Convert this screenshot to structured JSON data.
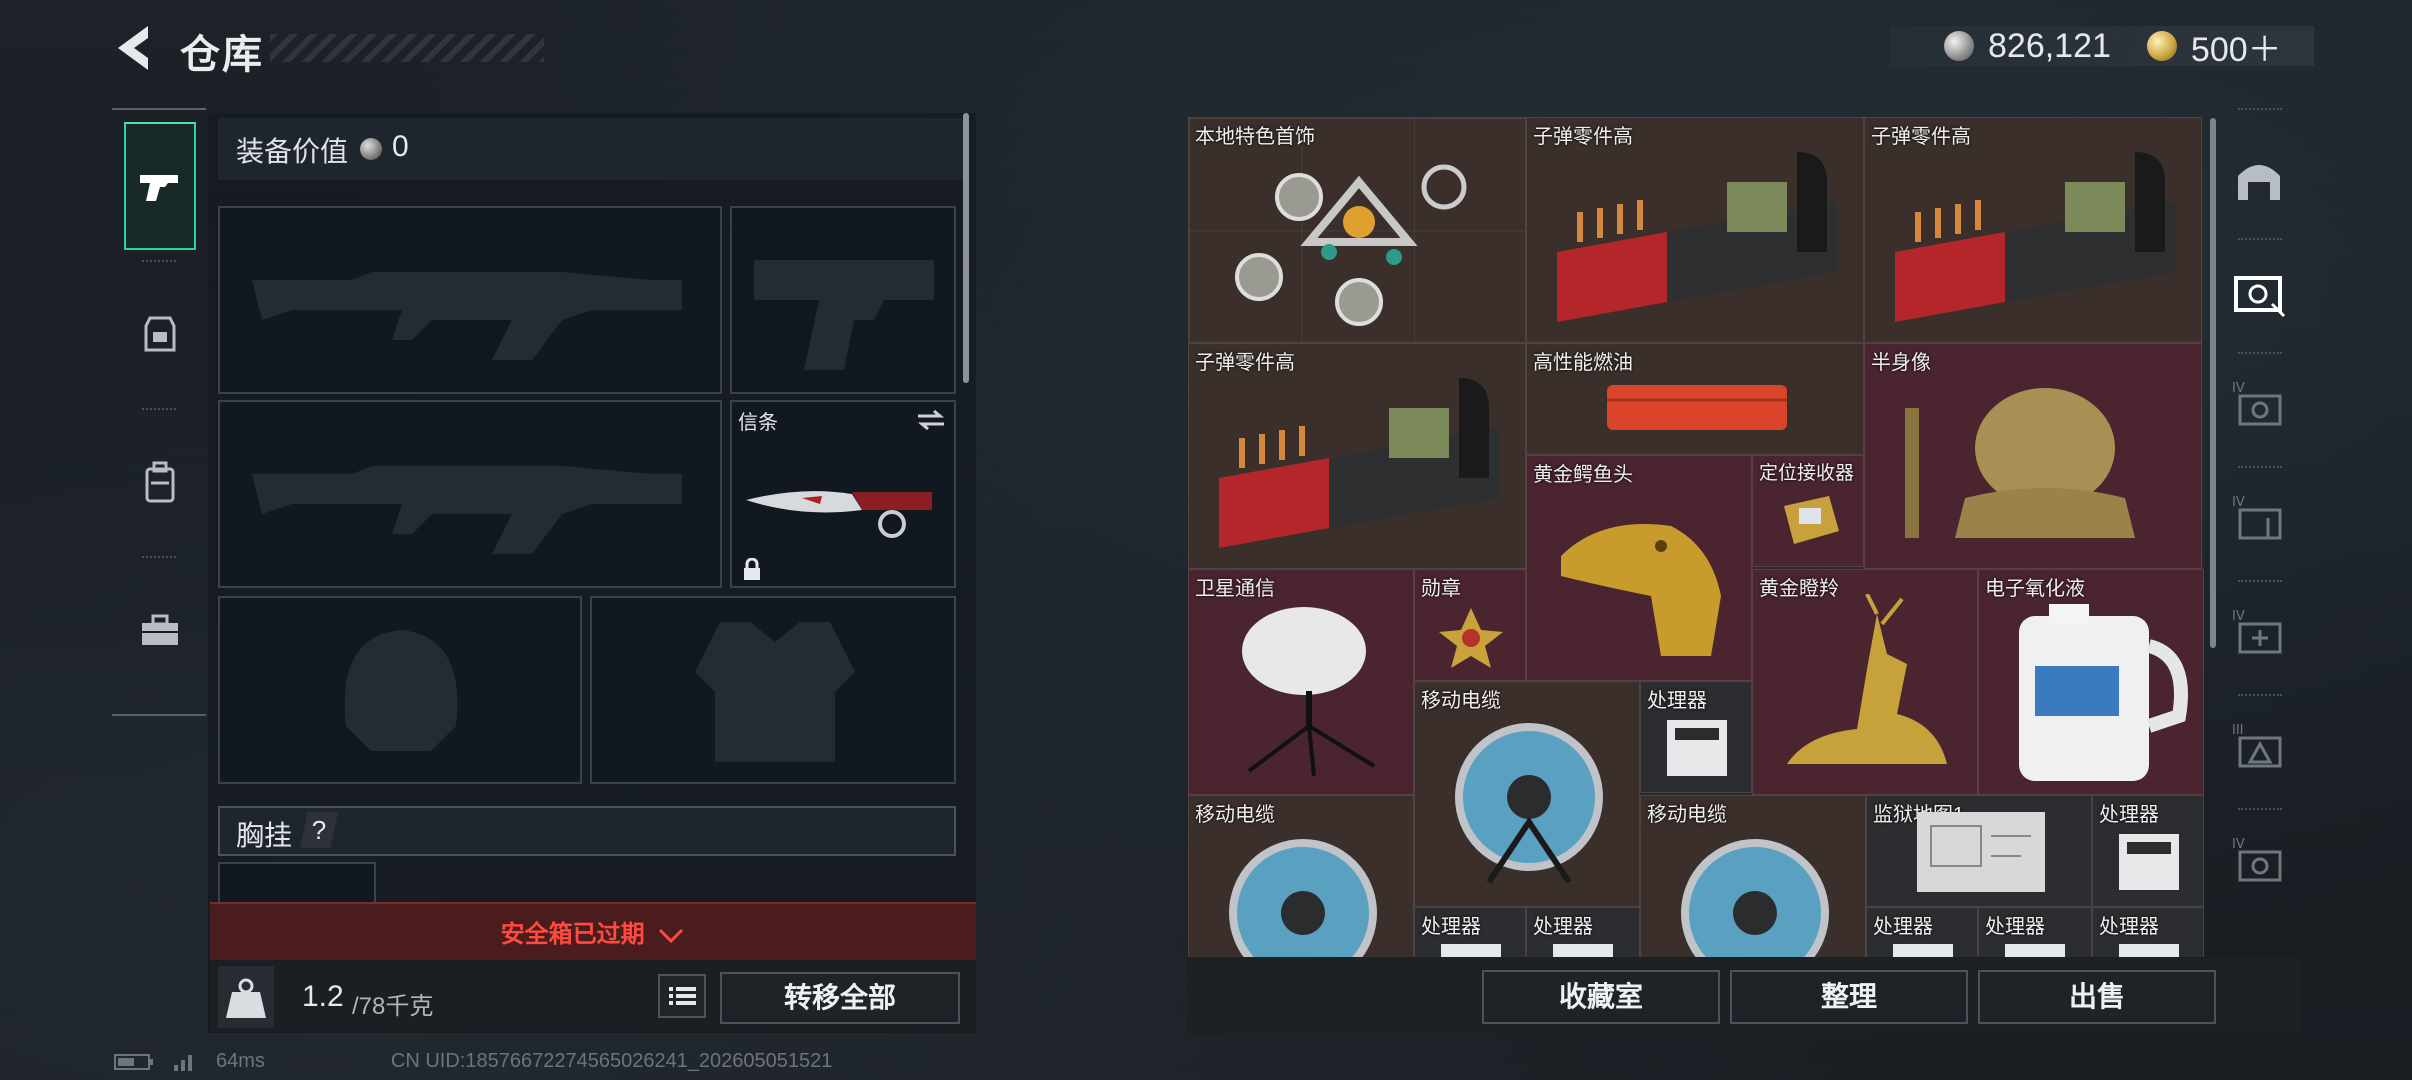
{
  "header": {
    "title": "仓库",
    "currency": [
      {
        "icon": "silver-coin-icon",
        "value": "826,121"
      },
      {
        "icon": "gold-coin-icon",
        "value": "500＋"
      }
    ]
  },
  "left_tabs": [
    {
      "icon": "pistol-icon",
      "active": true
    },
    {
      "icon": "backpack-armor-icon",
      "active": false
    },
    {
      "icon": "backpack-icon",
      "active": false
    },
    {
      "icon": "toolbox-icon",
      "active": false
    }
  ],
  "equipment": {
    "value_label": "装备价值",
    "value": "0",
    "melee_label": "信条",
    "chest_label": "胸挂",
    "chest_help": "?",
    "safebox_text": "安全箱已过期",
    "weight_current": "1.2",
    "weight_max": "/78千克",
    "transfer_all": "转移全部"
  },
  "storage": {
    "items": [
      {
        "name": "本地特色首饰"
      },
      {
        "name": "子弹零件高"
      },
      {
        "name": "子弹零件高"
      },
      {
        "name": "子弹零件高"
      },
      {
        "name": "高性能燃油"
      },
      {
        "name": "半身像"
      },
      {
        "name": "黄金鳄鱼头"
      },
      {
        "name": "定位接收器"
      },
      {
        "name": "卫星通信"
      },
      {
        "name": "勋章"
      },
      {
        "name": "黄金瞪羚"
      },
      {
        "name": "电子氧化液"
      },
      {
        "name": "移动电缆"
      },
      {
        "name": "处理器"
      },
      {
        "name": "移动电缆"
      },
      {
        "name": "移动电缆"
      },
      {
        "name": "监狱地图1"
      },
      {
        "name": "处理器"
      },
      {
        "name": "处理器"
      },
      {
        "name": "处理器"
      },
      {
        "name": "处理器"
      },
      {
        "name": "处理器"
      },
      {
        "name": "处理器"
      }
    ],
    "buttons": {
      "collection": "收藏室",
      "sort": "整理",
      "sell": "出售"
    }
  },
  "right_sidebar": [
    {
      "icon": "safehouse-icon"
    },
    {
      "icon": "storage-page-icon",
      "active": true
    },
    {
      "icon": "storage-page-iv-icon"
    },
    {
      "icon": "storage-page-iv-icon"
    },
    {
      "icon": "storage-page-iv-add-icon"
    },
    {
      "icon": "storage-page-iii-icon"
    },
    {
      "icon": "storage-page-iv-icon"
    },
    {
      "icon": "settings-gear-icon"
    }
  ],
  "status": {
    "ping": "64ms",
    "uid": "CN UID:18576672274565026241_202605051521"
  },
  "colors": {
    "accent_green": "#2ed3a2",
    "alert_red": "#ff4a3f",
    "expired_bg": "#4b1c1e"
  }
}
